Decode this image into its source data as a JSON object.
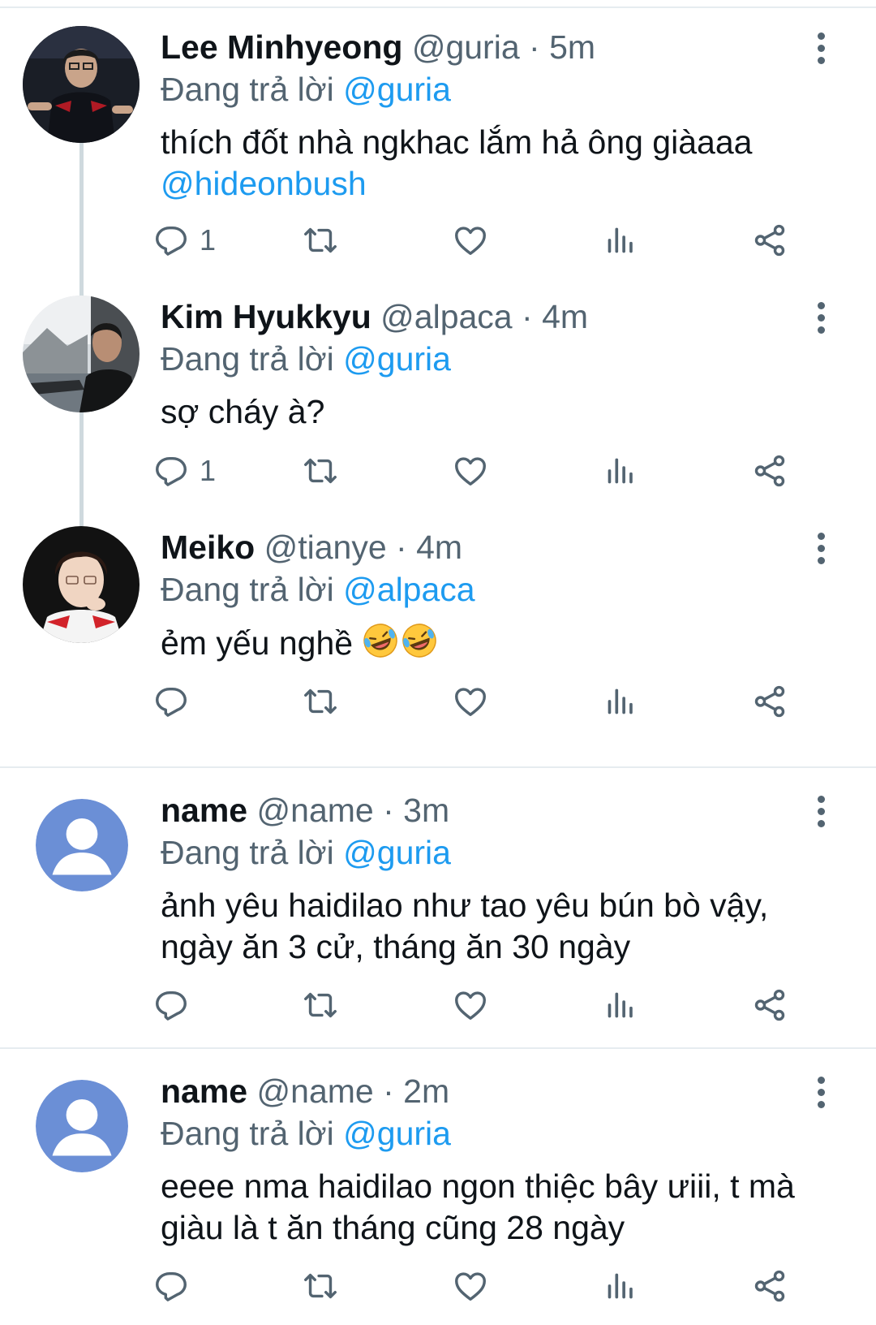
{
  "tweets": [
    {
      "name": "Lee Minhyeong",
      "handle": "@guria",
      "time": "5m",
      "replying_prefix": "Đang trả lời ",
      "replying_to": "@guria",
      "text": "thích đốt nhà ngkhac lắm hả ông giàaaa",
      "mention": "@hideonbush",
      "reply_count": "1"
    },
    {
      "name": "Kim Hyukkyu",
      "handle": "@alpaca",
      "time": "4m",
      "replying_prefix": "Đang trả lời ",
      "replying_to": "@guria",
      "text": "sợ cháy à?",
      "reply_count": "1"
    },
    {
      "name": "Meiko",
      "handle": "@tianye",
      "time": "4m",
      "replying_prefix": "Đang trả lời ",
      "replying_to": "@alpaca",
      "text": "ẻm yếu nghề",
      "reply_count": ""
    },
    {
      "name": "name",
      "handle": "@name",
      "time": "3m",
      "replying_prefix": "Đang trả lời ",
      "replying_to": "@guria",
      "text": "ảnh yêu haidilao như tao yêu bún bò vậy,",
      "text2": "ngày ăn 3 cử, tháng ăn 30 ngày",
      "reply_count": ""
    },
    {
      "name": "name",
      "handle": "@name",
      "time": "2m",
      "replying_prefix": "Đang trả lời ",
      "replying_to": "@guria",
      "text": "eeee nma haidilao ngon thiệc bây ưiii, t mà",
      "text2": "giàu là t ăn tháng cũng 28 ngày",
      "reply_count": ""
    }
  ],
  "separator": " · ",
  "icons": {
    "reply": "reply-bubble-icon",
    "retweet": "retweet-icon",
    "like": "heart-icon",
    "views": "analytics-bars-icon",
    "share": "share-icon",
    "more": "more-vertical-icon",
    "emoji": "rolling-on-floor-laughing-emoji"
  },
  "colors": {
    "link": "#1d9bf0",
    "muted": "#536471",
    "text": "#0f1419",
    "thread_line": "#cfd9de",
    "default_avatar": "#6b8fd6"
  }
}
